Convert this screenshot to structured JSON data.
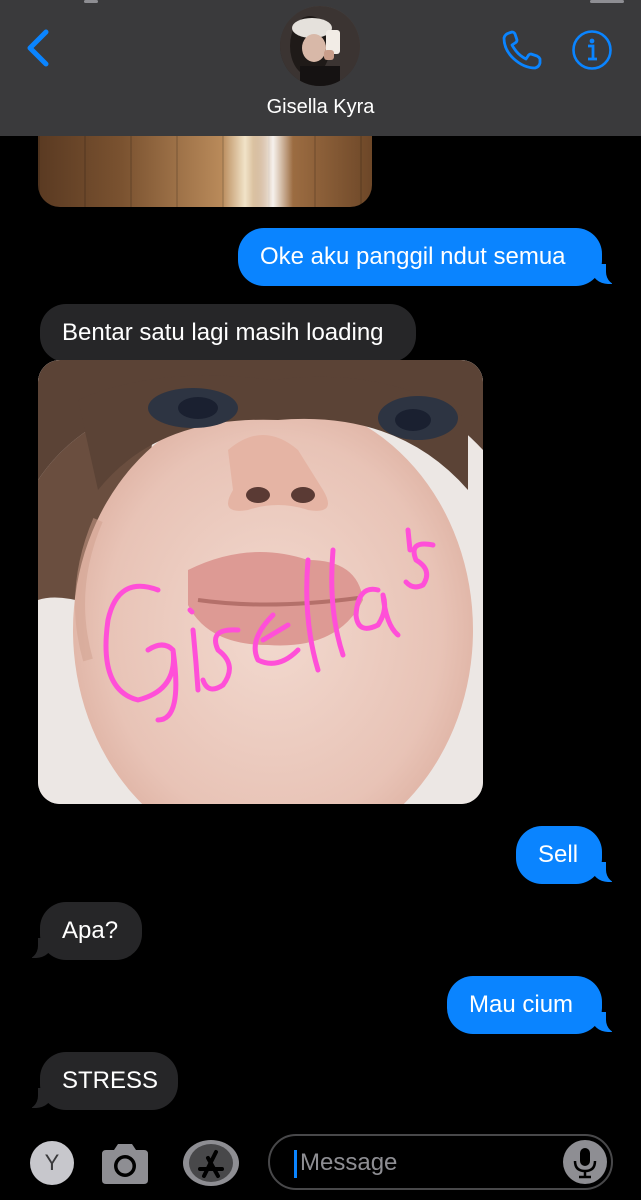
{
  "header": {
    "contact_name": "Gisella Kyra",
    "back_icon": "chevron-left-icon",
    "call_icon": "phone-icon",
    "info_icon": "info-icon",
    "accent_color": "#0a84ff"
  },
  "messages": [
    {
      "type": "image",
      "direction": "received",
      "description_icon": "photo-floor"
    },
    {
      "type": "text",
      "direction": "sent",
      "text": "Oke aku panggil ndut semua"
    },
    {
      "type": "text",
      "direction": "received",
      "text": "Bentar satu lagi masih loading"
    },
    {
      "type": "image",
      "direction": "received",
      "overlay_text": "Gisella's"
    },
    {
      "type": "text",
      "direction": "sent",
      "text": "Sell"
    },
    {
      "type": "text",
      "direction": "received",
      "text": "Apa?"
    },
    {
      "type": "text",
      "direction": "sent",
      "text": "Mau cium"
    },
    {
      "type": "text",
      "direction": "received",
      "text": "STRESS"
    }
  ],
  "input_bar": {
    "y_button_label": "Y",
    "camera_icon": "camera-icon",
    "appstore_icon": "app-store-icon",
    "message_placeholder": "Message",
    "mic_icon": "microphone-icon"
  }
}
